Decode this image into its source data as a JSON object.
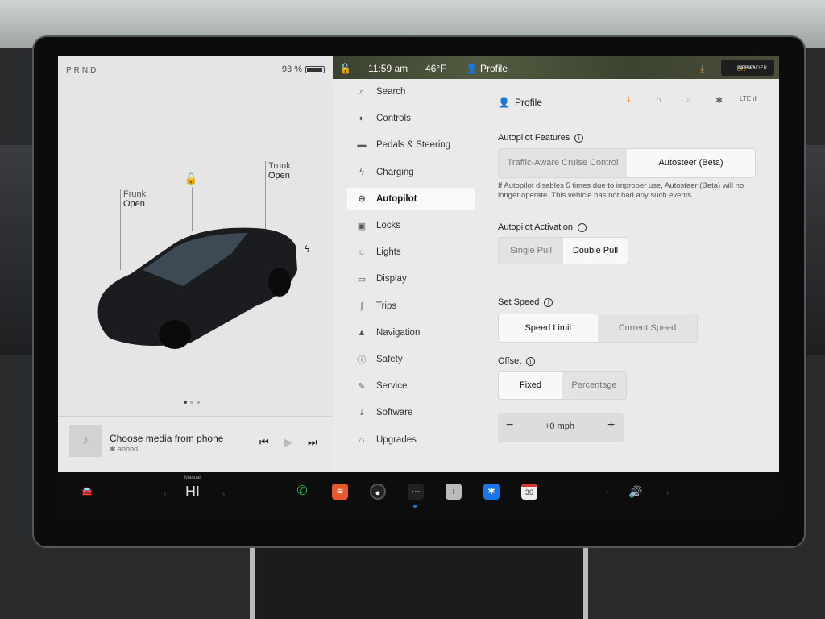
{
  "status": {
    "gear": "PRND",
    "battery": "93 %",
    "battery_level": 0.93,
    "time": "11:59 am",
    "temperature": "46°F",
    "profile": "Profile",
    "airbag_line1": "PASSENGER",
    "airbag_line2": "AIRBAG",
    "airbag_state": "OFF"
  },
  "car": {
    "frunk_label": "Frunk",
    "frunk_state": "Open",
    "trunk_label": "Trunk",
    "trunk_state": "Open",
    "page_dots": 3,
    "active_dot": 1
  },
  "media": {
    "title": "Choose media from phone",
    "source": "abbod"
  },
  "menu": [
    {
      "label": "Search",
      "icon": "search-icon",
      "glyph": "⌕"
    },
    {
      "label": "Controls",
      "icon": "toggle-icon",
      "glyph": "◐"
    },
    {
      "label": "Pedals & Steering",
      "icon": "car-icon",
      "glyph": "▬"
    },
    {
      "label": "Charging",
      "icon": "lightning-icon",
      "glyph": "ϟ"
    },
    {
      "label": "Autopilot",
      "icon": "steering-wheel-icon",
      "glyph": "⊖",
      "selected": true
    },
    {
      "label": "Locks",
      "icon": "lock-icon",
      "glyph": "▣"
    },
    {
      "label": "Lights",
      "icon": "light-icon",
      "glyph": "☼"
    },
    {
      "label": "Display",
      "icon": "display-icon",
      "glyph": "▭"
    },
    {
      "label": "Trips",
      "icon": "trips-icon",
      "glyph": "∫"
    },
    {
      "label": "Navigation",
      "icon": "navigation-icon",
      "glyph": "▲"
    },
    {
      "label": "Safety",
      "icon": "safety-icon",
      "glyph": "ⓘ"
    },
    {
      "label": "Service",
      "icon": "wrench-icon",
      "glyph": "✎"
    },
    {
      "label": "Software",
      "icon": "download-icon",
      "glyph": "⤓"
    },
    {
      "label": "Upgrades",
      "icon": "bag-icon",
      "glyph": "⌂"
    }
  ],
  "content": {
    "profile": "Profile",
    "features_title": "Autopilot Features",
    "features": [
      "Traffic-Aware Cruise Control",
      "Autosteer (Beta)"
    ],
    "features_selected": 1,
    "note": "If Autopilot disables 5 times due to improper use, Autosteer (Beta) will no longer operate. This vehicle has not had any such events.",
    "activation_title": "Autopilot Activation",
    "activation": [
      "Single Pull",
      "Double Pull"
    ],
    "activation_selected": 1,
    "speed_title": "Set Speed",
    "speed": [
      "Speed Limit",
      "Current Speed"
    ],
    "speed_selected": 0,
    "offset_title": "Offset",
    "offset": [
      "Fixed",
      "Percentage"
    ],
    "offset_selected": 0,
    "offset_value": "+0 mph",
    "minus": "−",
    "plus": "+"
  },
  "dock": {
    "climate_mode": "Manual",
    "climate_value": "HI"
  },
  "colors": {
    "accent_orange": "#e08a1e",
    "phone_green": "#2bc451",
    "bluetooth_blue": "#1a74e8"
  }
}
